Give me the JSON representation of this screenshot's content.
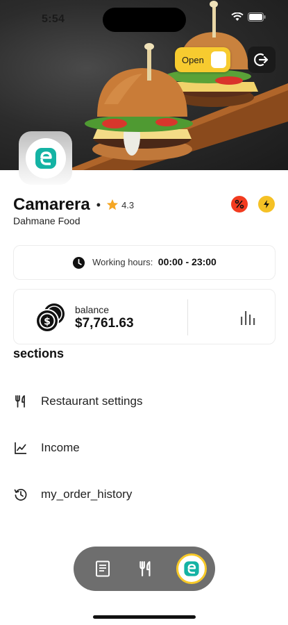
{
  "status_bar": {
    "time": "5:54"
  },
  "hero": {
    "open_toggle": {
      "label": "Open",
      "state": "on",
      "color": "#f7cb2f"
    },
    "logout_icon": "logout-icon",
    "logo_icon": "restaurant-logo-e"
  },
  "restaurant": {
    "name": "Camarera",
    "separator": "•",
    "rating": "4.3",
    "subtitle": "Dahmane Food",
    "badges": [
      {
        "icon": "percent-icon",
        "color": "#f23b1f"
      },
      {
        "icon": "flash-icon",
        "color": "#f5c125"
      }
    ]
  },
  "hours": {
    "label": "Working hours:",
    "value": "00:00 - 23:00"
  },
  "balance": {
    "label": "balance",
    "value": "$7,761.63"
  },
  "sections": {
    "title": "sections",
    "items": [
      {
        "label": "Restaurant settings",
        "icon": "fork-knife-icon"
      },
      {
        "label": "Income",
        "icon": "line-chart-icon"
      },
      {
        "label": "my_order_history",
        "icon": "history-icon"
      }
    ]
  },
  "bottom_nav": {
    "items": [
      {
        "icon": "orders-list-icon",
        "active": false
      },
      {
        "icon": "fork-knife-icon",
        "active": false
      },
      {
        "icon": "restaurant-logo-e",
        "active": true
      }
    ],
    "accent": "#f7c928"
  },
  "colors": {
    "brand_teal": "#14b3a4",
    "accent_yellow": "#f7cb2f",
    "star": "#f5a623"
  }
}
